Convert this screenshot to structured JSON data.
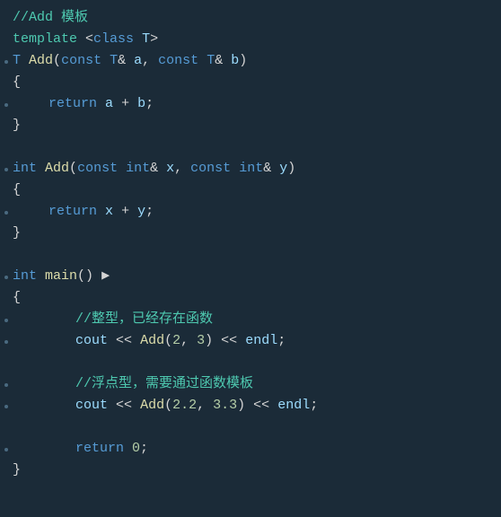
{
  "editor": {
    "background": "#1b2b38",
    "lines": [
      {
        "id": 1,
        "dot": false,
        "indent": 0,
        "tokens": [
          {
            "cls": "c-comment",
            "text": "//Add 模板"
          }
        ]
      },
      {
        "id": 2,
        "dot": false,
        "indent": 0,
        "tokens": [
          {
            "cls": "c-template-kw",
            "text": "template"
          },
          {
            "cls": "c-plain",
            "text": " "
          },
          {
            "cls": "c-punct",
            "text": "<"
          },
          {
            "cls": "c-keyword",
            "text": "class"
          },
          {
            "cls": "c-plain",
            "text": " "
          },
          {
            "cls": "c-param",
            "text": "T"
          },
          {
            "cls": "c-punct",
            "text": ">"
          }
        ]
      },
      {
        "id": 3,
        "dot": true,
        "indent": 0,
        "tokens": [
          {
            "cls": "c-type",
            "text": "T"
          },
          {
            "cls": "c-plain",
            "text": " "
          },
          {
            "cls": "c-func",
            "text": "Add"
          },
          {
            "cls": "c-punct",
            "text": "("
          },
          {
            "cls": "c-keyword",
            "text": "const"
          },
          {
            "cls": "c-plain",
            "text": " "
          },
          {
            "cls": "c-type",
            "text": "T"
          },
          {
            "cls": "c-punct",
            "text": "&"
          },
          {
            "cls": "c-plain",
            "text": " "
          },
          {
            "cls": "c-param",
            "text": "a"
          },
          {
            "cls": "c-punct",
            "text": ", "
          },
          {
            "cls": "c-keyword",
            "text": "const"
          },
          {
            "cls": "c-plain",
            "text": " "
          },
          {
            "cls": "c-type",
            "text": "T"
          },
          {
            "cls": "c-punct",
            "text": "&"
          },
          {
            "cls": "c-plain",
            "text": " "
          },
          {
            "cls": "c-param",
            "text": "b"
          },
          {
            "cls": "c-punct",
            "text": ")"
          }
        ]
      },
      {
        "id": 4,
        "dot": false,
        "indent": 0,
        "tokens": [
          {
            "cls": "c-punct",
            "text": "{"
          }
        ]
      },
      {
        "id": 5,
        "dot": true,
        "indent": 1,
        "tokens": [
          {
            "cls": "c-return",
            "text": "return"
          },
          {
            "cls": "c-plain",
            "text": " "
          },
          {
            "cls": "c-param",
            "text": "a"
          },
          {
            "cls": "c-plain",
            "text": " "
          },
          {
            "cls": "c-op",
            "text": "+"
          },
          {
            "cls": "c-plain",
            "text": " "
          },
          {
            "cls": "c-param",
            "text": "b"
          },
          {
            "cls": "c-punct",
            "text": ";"
          }
        ]
      },
      {
        "id": 6,
        "dot": false,
        "indent": 0,
        "tokens": [
          {
            "cls": "c-punct",
            "text": "}"
          }
        ]
      },
      {
        "id": 7,
        "dot": false,
        "indent": 0,
        "tokens": []
      },
      {
        "id": 8,
        "dot": true,
        "indent": 0,
        "tokens": [
          {
            "cls": "c-keyword",
            "text": "int"
          },
          {
            "cls": "c-plain",
            "text": " "
          },
          {
            "cls": "c-func",
            "text": "Add"
          },
          {
            "cls": "c-punct",
            "text": "("
          },
          {
            "cls": "c-keyword",
            "text": "const"
          },
          {
            "cls": "c-plain",
            "text": " "
          },
          {
            "cls": "c-type",
            "text": "int"
          },
          {
            "cls": "c-punct",
            "text": "&"
          },
          {
            "cls": "c-plain",
            "text": " "
          },
          {
            "cls": "c-param",
            "text": "x"
          },
          {
            "cls": "c-punct",
            "text": ", "
          },
          {
            "cls": "c-keyword",
            "text": "const"
          },
          {
            "cls": "c-plain",
            "text": " "
          },
          {
            "cls": "c-type",
            "text": "int"
          },
          {
            "cls": "c-punct",
            "text": "&"
          },
          {
            "cls": "c-plain",
            "text": " "
          },
          {
            "cls": "c-param",
            "text": "y"
          },
          {
            "cls": "c-punct",
            "text": ")"
          }
        ]
      },
      {
        "id": 9,
        "dot": false,
        "indent": 0,
        "tokens": [
          {
            "cls": "c-punct",
            "text": "{"
          }
        ]
      },
      {
        "id": 10,
        "dot": true,
        "indent": 1,
        "tokens": [
          {
            "cls": "c-return",
            "text": "return"
          },
          {
            "cls": "c-plain",
            "text": " "
          },
          {
            "cls": "c-param",
            "text": "x"
          },
          {
            "cls": "c-plain",
            "text": " "
          },
          {
            "cls": "c-op",
            "text": "+"
          },
          {
            "cls": "c-plain",
            "text": " "
          },
          {
            "cls": "c-param",
            "text": "y"
          },
          {
            "cls": "c-punct",
            "text": ";"
          }
        ]
      },
      {
        "id": 11,
        "dot": false,
        "indent": 0,
        "tokens": [
          {
            "cls": "c-punct",
            "text": "}"
          }
        ]
      },
      {
        "id": 12,
        "dot": false,
        "indent": 0,
        "tokens": []
      },
      {
        "id": 13,
        "dot": true,
        "indent": 0,
        "tokens": [
          {
            "cls": "c-keyword",
            "text": "int"
          },
          {
            "cls": "c-plain",
            "text": " "
          },
          {
            "cls": "c-func",
            "text": "main"
          },
          {
            "cls": "c-punct",
            "text": "()"
          },
          {
            "cls": "c-plain",
            "text": " ▶"
          }
        ]
      },
      {
        "id": 14,
        "dot": false,
        "indent": 0,
        "tokens": [
          {
            "cls": "c-punct",
            "text": "{"
          }
        ]
      },
      {
        "id": 15,
        "dot": true,
        "indent": 2,
        "tokens": [
          {
            "cls": "c-comment",
            "text": "//整型，已经存在函数"
          }
        ]
      },
      {
        "id": 16,
        "dot": true,
        "indent": 2,
        "tokens": [
          {
            "cls": "c-stream",
            "text": "cout"
          },
          {
            "cls": "c-plain",
            "text": " "
          },
          {
            "cls": "c-op",
            "text": "<<"
          },
          {
            "cls": "c-plain",
            "text": " "
          },
          {
            "cls": "c-func",
            "text": "Add"
          },
          {
            "cls": "c-punct",
            "text": "("
          },
          {
            "cls": "c-num",
            "text": "2"
          },
          {
            "cls": "c-punct",
            "text": ", "
          },
          {
            "cls": "c-num",
            "text": "3"
          },
          {
            "cls": "c-punct",
            "text": ")"
          },
          {
            "cls": "c-plain",
            "text": " "
          },
          {
            "cls": "c-op",
            "text": "<<"
          },
          {
            "cls": "c-plain",
            "text": " "
          },
          {
            "cls": "c-stream",
            "text": "endl"
          },
          {
            "cls": "c-punct",
            "text": ";"
          }
        ]
      },
      {
        "id": 17,
        "dot": false,
        "indent": 0,
        "tokens": []
      },
      {
        "id": 18,
        "dot": true,
        "indent": 2,
        "tokens": [
          {
            "cls": "c-comment",
            "text": "//浮点型，需要通过函数模板"
          }
        ]
      },
      {
        "id": 19,
        "dot": true,
        "indent": 2,
        "tokens": [
          {
            "cls": "c-stream",
            "text": "cout"
          },
          {
            "cls": "c-plain",
            "text": " "
          },
          {
            "cls": "c-op",
            "text": "<<"
          },
          {
            "cls": "c-plain",
            "text": " "
          },
          {
            "cls": "c-func",
            "text": "Add"
          },
          {
            "cls": "c-punct",
            "text": "("
          },
          {
            "cls": "c-num",
            "text": "2.2"
          },
          {
            "cls": "c-punct",
            "text": ", "
          },
          {
            "cls": "c-num",
            "text": "3.3"
          },
          {
            "cls": "c-punct",
            "text": ")"
          },
          {
            "cls": "c-plain",
            "text": " "
          },
          {
            "cls": "c-op",
            "text": "<<"
          },
          {
            "cls": "c-plain",
            "text": " "
          },
          {
            "cls": "c-stream",
            "text": "endl"
          },
          {
            "cls": "c-punct",
            "text": ";"
          }
        ]
      },
      {
        "id": 20,
        "dot": false,
        "indent": 0,
        "tokens": []
      },
      {
        "id": 21,
        "dot": true,
        "indent": 2,
        "tokens": [
          {
            "cls": "c-return",
            "text": "return"
          },
          {
            "cls": "c-plain",
            "text": " "
          },
          {
            "cls": "c-num",
            "text": "0"
          },
          {
            "cls": "c-punct",
            "text": ";"
          }
        ]
      },
      {
        "id": 22,
        "dot": false,
        "indent": 0,
        "tokens": [
          {
            "cls": "c-punct",
            "text": "}"
          }
        ]
      }
    ]
  }
}
